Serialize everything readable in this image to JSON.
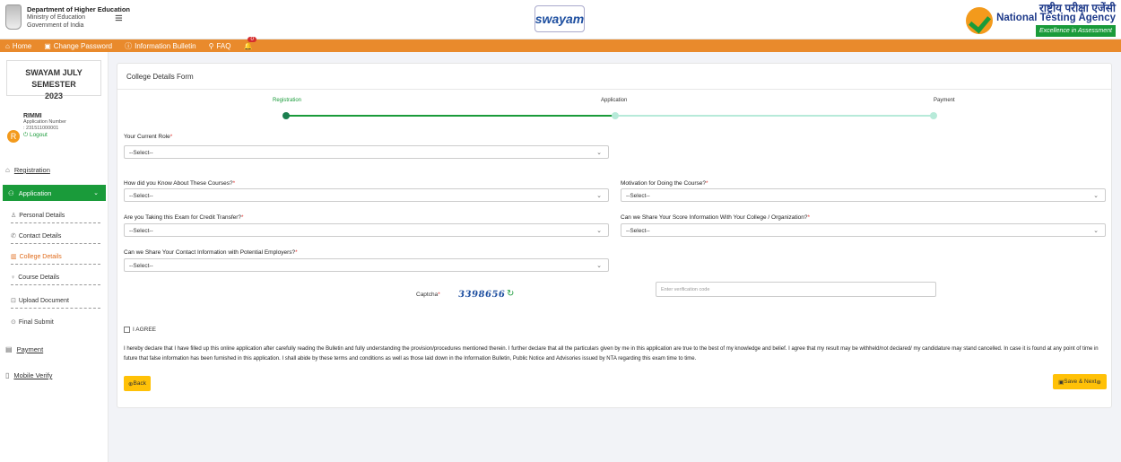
{
  "header": {
    "dept_line1": "Department of Higher Education",
    "dept_line2": "Ministry of Education",
    "dept_line3": "Government of India",
    "menu_glyph": "≡",
    "center_logo": "swayam",
    "nta_hindi": "राष्ट्रीय परीक्षा एजेंसी",
    "nta_english": "National Testing Agency",
    "nta_tagline": "Excellence in Assessment"
  },
  "nav": {
    "home": "Home",
    "change_password": "Change Password",
    "info_bulletin": "Information Bulletin",
    "faq": "FAQ",
    "bell_count": "0"
  },
  "sidebar": {
    "semester_line1": "SWAYAM JULY SEMESTER",
    "semester_line2": "2023",
    "avatar_letter": "R",
    "user_name": "RIMMI",
    "app_no_label": "Application Number",
    "app_no": ": 231511000001",
    "logout": "Logout",
    "registration": "Registration",
    "application": "Application",
    "personal": "Personal Details",
    "contact": "Contact Details",
    "college": "College Details",
    "course": "Course Details",
    "upload": "Upload Document",
    "final": "Final Submit",
    "payment": "Payment",
    "mobile": "Mobile Verify"
  },
  "form": {
    "title": "College Details Form",
    "steps": [
      "Registration",
      "Application",
      "Payment"
    ],
    "role_label": "Your Current Role",
    "how_label": "How did you Know About These Courses?",
    "motivation_label": "Motivation for Doing the Course?",
    "credit_label": "Are you Taking this Exam for Credit Transfer?",
    "share_score_label": "Can we Share Your Score Information With Your College / Organization?",
    "share_contact_label": "Can we Share Your Contact Information with Potential Employers?",
    "select_placeholder": "--Select--",
    "req": "*",
    "captcha_label": "Captcha",
    "captcha_value": "3398656",
    "captcha_placeholder": "Enter verification code",
    "agree": "I AGREE",
    "declaration": "I hereby declare that I have filled up this online application after carefully reading the Bulletin and fully understanding the provision/procedures mentioned therein. I further declare that all the particulars given by me in this application are true to the best of my knowledge and belief. I agree that my result may be withheld/not declared/ my candidature may stand cancelled. In case it is found at any point of time in future that false information has been furnished in this application. I shall abide by these terms and conditions as well as those laid down in the Information Bulletin, Public Notice and Advisories issued by NTA regarding this exam time to time.",
    "back": "Back",
    "save_next": "Save & Next"
  },
  "colors": {
    "nav_orange": "#e98a2c",
    "accent_green": "#1a9b3a",
    "button_yellow": "#ffc107",
    "active_link": "#e06b1b"
  }
}
